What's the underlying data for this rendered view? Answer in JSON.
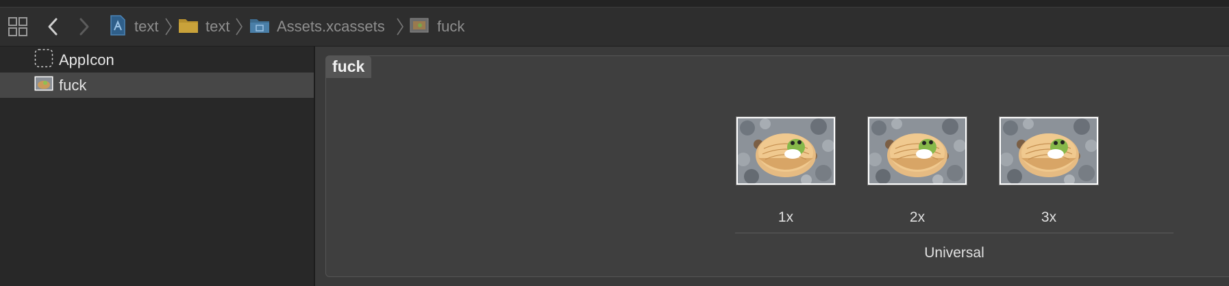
{
  "toolbar": {
    "grid_icon": "grid-icon",
    "back_icon": "chevron-left-icon",
    "forward_icon": "chevron-right-icon"
  },
  "breadcrumb": {
    "items": [
      {
        "label": "text",
        "icon": "project-file-icon"
      },
      {
        "label": "text",
        "icon": "folder-icon"
      },
      {
        "label": "Assets.xcassets",
        "icon": "asset-catalog-icon"
      },
      {
        "label": "fuck",
        "icon": "image-set-icon"
      }
    ]
  },
  "sidebar": {
    "items": [
      {
        "label": "AppIcon",
        "icon": "app-icon-placeholder-icon",
        "selected": false
      },
      {
        "label": "fuck",
        "icon": "image-set-icon",
        "selected": true
      }
    ]
  },
  "editor": {
    "asset_title": "fuck",
    "slots": [
      {
        "label": "1x"
      },
      {
        "label": "2x"
      },
      {
        "label": "3x"
      }
    ],
    "group_label": "Universal"
  },
  "colors": {
    "background": "#2b2b2b",
    "sidebar_selected": "#474747",
    "crumb_text": "#8e8e8e",
    "folder_yellow": "#c9a23a",
    "catalog_blue": "#4a7fa8"
  }
}
